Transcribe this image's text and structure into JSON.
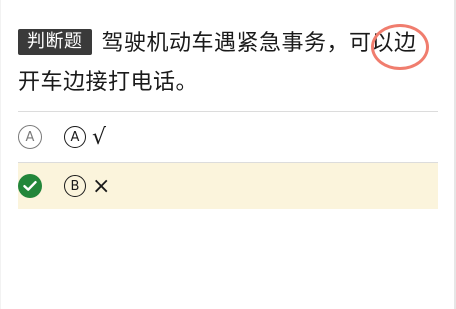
{
  "question": {
    "type_badge": "判断题",
    "text": "驾驶机动车遇紧急事务，可以边开车边接打电话。"
  },
  "options": [
    {
      "indicator_letter": "A",
      "letter": "A",
      "answer": "√",
      "state": "unselected",
      "icon": "circled-a-icon"
    },
    {
      "indicator_letter": "",
      "letter": "B",
      "answer": "×",
      "state": "correct",
      "icon": "check-circle-icon"
    }
  ],
  "colors": {
    "badge_bg": "#3a3a3a",
    "highlight_circle": "#f07d6e",
    "correct_green": "#22863a",
    "correct_row_bg": "#fbf4dc",
    "divider": "#dcdcdc"
  }
}
